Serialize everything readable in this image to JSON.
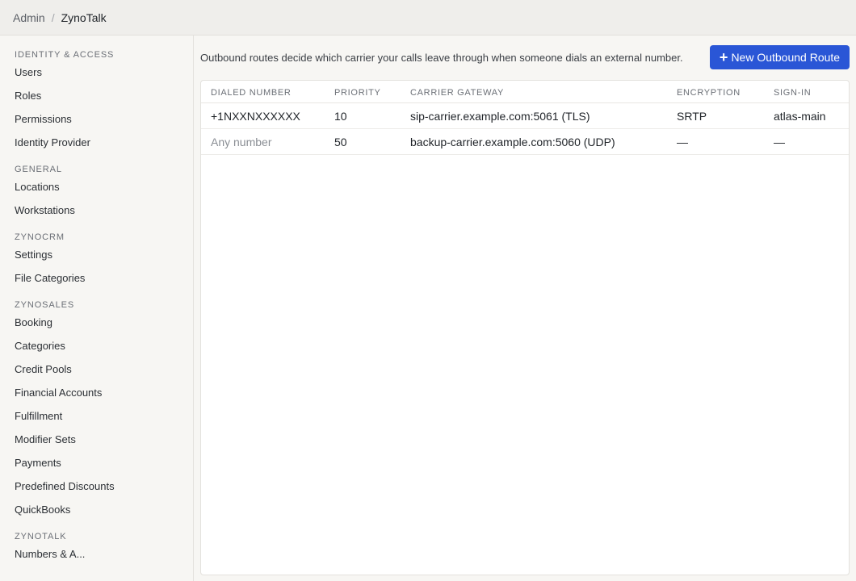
{
  "breadcrumb": {
    "root": "Admin",
    "separator": "/",
    "current": "ZynoTalk"
  },
  "sidebar": {
    "groups": [
      {
        "title": "IDENTITY & ACCESS",
        "items": [
          "Users",
          "Roles",
          "Permissions",
          "Identity Provider"
        ]
      },
      {
        "title": "GENERAL",
        "items": [
          "Locations",
          "Workstations"
        ]
      },
      {
        "title": "ZYNOCRM",
        "items": [
          "Settings",
          "File Categories"
        ]
      },
      {
        "title": "ZYNOSALES",
        "items": [
          "Booking",
          "Categories",
          "Credit Pools",
          "Financial Accounts",
          "Fulfillment",
          "Modifier Sets",
          "Payments",
          "Predefined Discounts",
          "QuickBooks"
        ]
      },
      {
        "title": "ZYNOTALK",
        "items": [
          "Numbers & A..."
        ]
      }
    ]
  },
  "main": {
    "description": "Outbound routes decide which carrier your calls leave through when someone dials an external number.",
    "new_button": {
      "icon": "plus-icon",
      "label": "New Outbound Route"
    },
    "table": {
      "columns": [
        "DIALED NUMBER",
        "PRIORITY",
        "CARRIER GATEWAY",
        "ENCRYPTION",
        "SIGN-IN"
      ],
      "rows": [
        {
          "dialed": "+1NXXNXXXXXX",
          "priority": "10",
          "gateway": "sip-carrier.example.com:5061 (TLS)",
          "encryption": "SRTP",
          "signin": "atlas-main"
        },
        {
          "dialed": "Any number",
          "priority": "50",
          "gateway": "backup-carrier.example.com:5060 (UDP)",
          "encryption": "—",
          "signin": "—"
        }
      ]
    }
  },
  "colors": {
    "accent": "#2a56d6",
    "muted_text": "#8a8e94"
  }
}
